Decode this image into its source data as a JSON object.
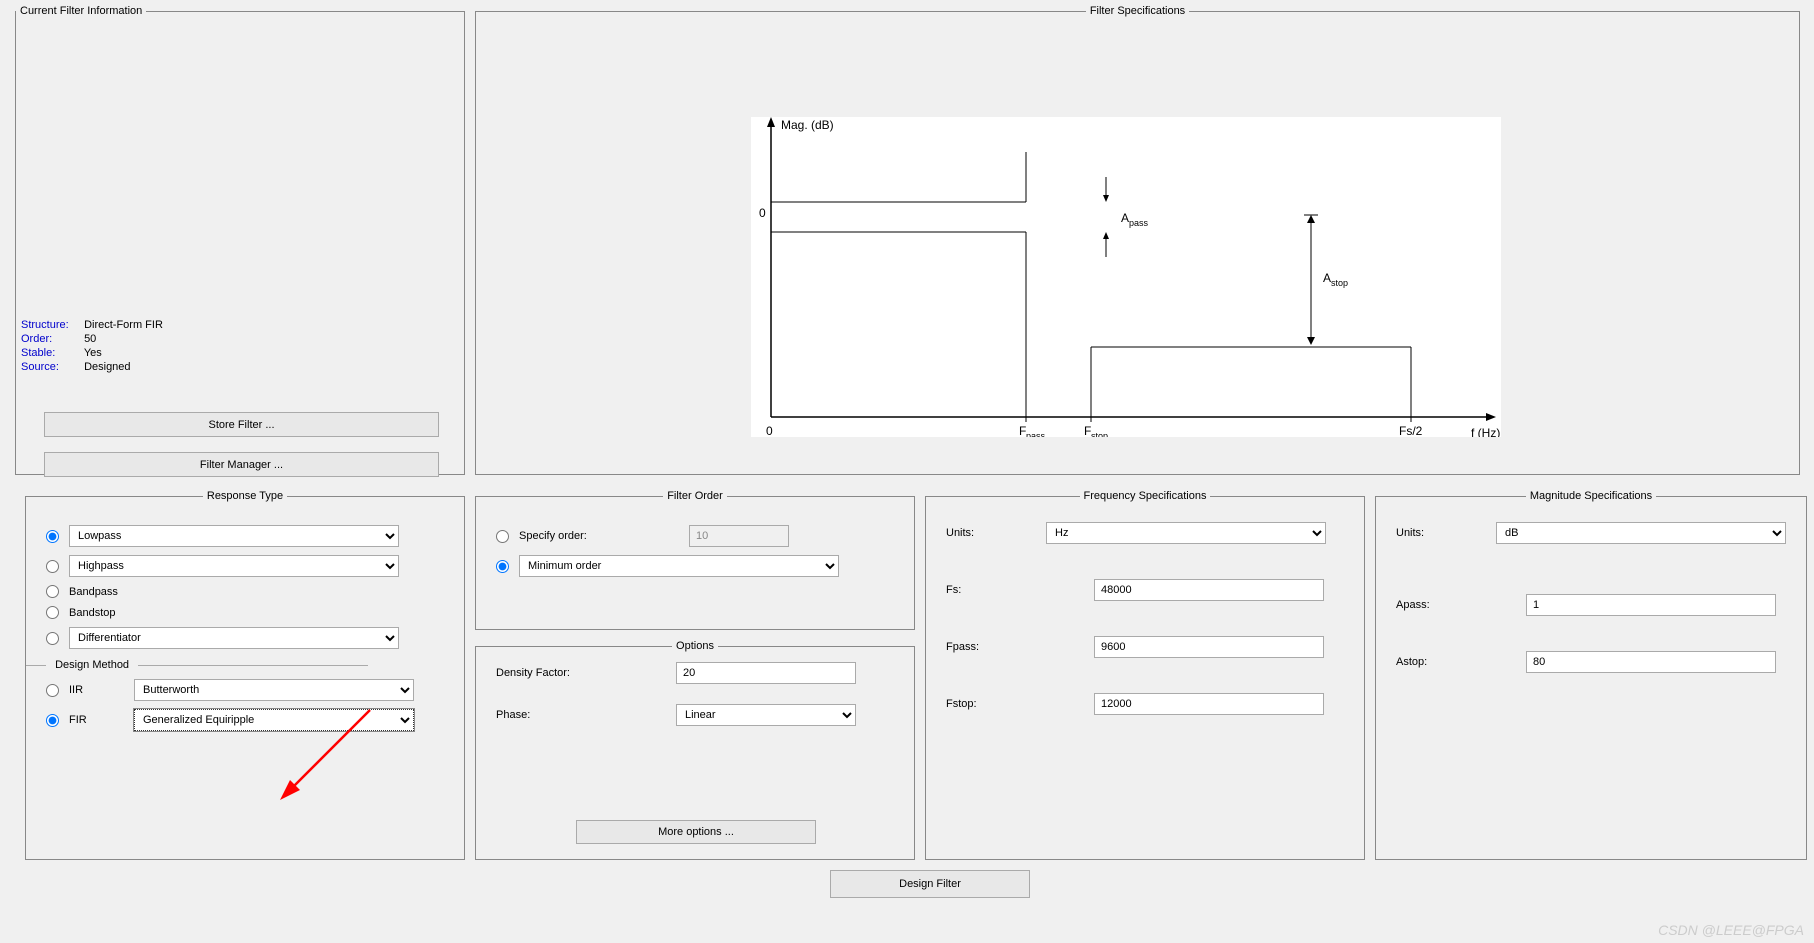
{
  "filterInfo": {
    "legend": "Current Filter Information",
    "rows": {
      "structureLabel": "Structure:",
      "structureValue": "Direct-Form FIR",
      "orderLabel": "Order:",
      "orderValue": "50",
      "stableLabel": "Stable:",
      "stableValue": "Yes",
      "sourceLabel": "Source:",
      "sourceValue": "Designed"
    },
    "storeBtn": "Store Filter ...",
    "managerBtn": "Filter Manager ..."
  },
  "filterSpec": {
    "legend": "Filter Specifications",
    "ylabel": "Mag. (dB)",
    "xlabel": "f (Hz)",
    "zero": "0",
    "fpass": "F",
    "fpassSub": "pass",
    "fstop": "F",
    "fstopSub": "stop",
    "fs2": "Fs/2",
    "apass": "A",
    "apassSub": "pass",
    "astop": "A",
    "astopSub": "stop"
  },
  "responseType": {
    "legend": "Response Type",
    "lowpass": "Lowpass",
    "highpass": "Highpass",
    "bandpass": "Bandpass",
    "bandstop": "Bandstop",
    "differentiator": "Differentiator",
    "designMethod": "Design Method",
    "iir": "IIR",
    "iirMethod": "Butterworth",
    "fir": "FIR",
    "firMethod": "Generalized Equiripple"
  },
  "filterOrder": {
    "legend": "Filter Order",
    "specifyOrder": "Specify order:",
    "specifyValue": "10",
    "minOrder": "Minimum order"
  },
  "options": {
    "legend": "Options",
    "densityLabel": "Density Factor:",
    "densityValue": "20",
    "phaseLabel": "Phase:",
    "phaseValue": "Linear",
    "moreBtn": "More options ..."
  },
  "freqSpec": {
    "legend": "Frequency Specifications",
    "unitsLabel": "Units:",
    "unitsValue": "Hz",
    "fsLabel": "Fs:",
    "fsValue": "48000",
    "fpassLabel": "Fpass:",
    "fpassValue": "9600",
    "fstopLabel": "Fstop:",
    "fstopValue": "12000"
  },
  "magSpec": {
    "legend": "Magnitude Specifications",
    "unitsLabel": "Units:",
    "unitsValue": "dB",
    "apassLabel": "Apass:",
    "apassValue": "1",
    "astopLabel": "Astop:",
    "astopValue": "80"
  },
  "designBtn": "Design Filter",
  "watermark": "CSDN @LEEE@FPGA"
}
